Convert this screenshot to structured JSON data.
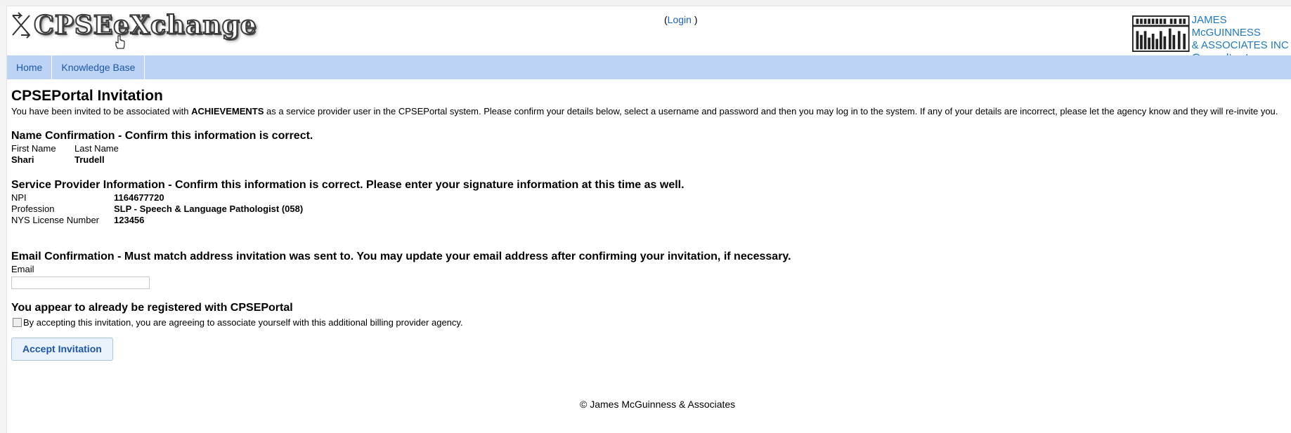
{
  "header": {
    "logo_text": "CPSEeXchange",
    "login_open": "(",
    "login_link": "Login",
    "login_close": " )",
    "brand_line1": "JAMES McGUINNESS",
    "brand_line2": "& ASSOCIATES INC",
    "brand_line3": "Consultants"
  },
  "nav": {
    "items": [
      {
        "label": "Home"
      },
      {
        "label": "Knowledge Base"
      }
    ]
  },
  "page": {
    "title": "CPSEPortal Invitation",
    "intro_pre": "You have been invited to be associated with ",
    "intro_agency": "ACHIEVEMENTS",
    "intro_post": " as a service provider user in the CPSEPortal system. Please confirm your details below, select a username and password and then you may log in to the system. If any of your details are incorrect, please let the agency know and they will re-invite you."
  },
  "name_section": {
    "heading": "Name Confirmation - Confirm this information is correct.",
    "first_label": "First Name",
    "last_label": "Last Name",
    "first_value": "Shari",
    "last_value": "Trudell"
  },
  "provider_section": {
    "heading": "Service Provider Information - Confirm this information is correct. Please enter your signature information at this time as well.",
    "rows": [
      {
        "label": "NPI",
        "value": "1164677720"
      },
      {
        "label": "Profession",
        "value": "SLP - Speech & Language Pathologist (058)"
      },
      {
        "label": "NYS License Number",
        "value": "123456"
      }
    ]
  },
  "email_section": {
    "heading": "Email Confirmation - Must match address invitation was sent to. You may update your email address after confirming your invitation, if necessary.",
    "label": "Email",
    "value": ""
  },
  "registered_section": {
    "heading": "You appear to already be registered with CPSEPortal",
    "checkbox_label": "By accepting this invitation, you are agreeing to associate yourself with this additional billing provider agency."
  },
  "accept_button": "Accept Invitation",
  "footer": "© James McGuinness & Associates",
  "colors": {
    "nav_bg": "#bcd3f5",
    "link": "#1d56a8",
    "brand": "#1e78c2"
  }
}
